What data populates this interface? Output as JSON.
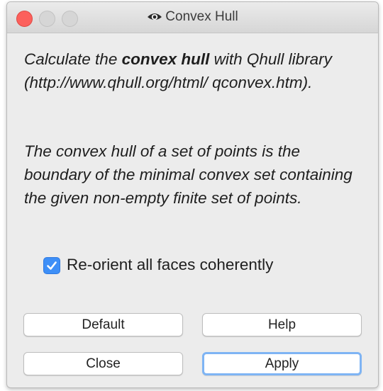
{
  "window": {
    "title": "Convex Hull",
    "app_icon": "meshlab-eye-icon"
  },
  "description": {
    "p1_before": "Calculate the ",
    "p1_bold": "convex hull",
    "p1_after": " with Qhull library (http://www.qhull.org/html/ qconvex.htm).",
    "p2": "The convex hull of a set of points is the boundary of the minimal convex set containing the given non-empty finite set of points."
  },
  "options": {
    "reorient_label": "Re-orient all faces coherently",
    "reorient_checked": true
  },
  "buttons": {
    "default_label": "Default",
    "help_label": "Help",
    "close_label": "Close",
    "apply_label": "Apply"
  },
  "colors": {
    "close_button": "#fc605c",
    "checkbox_accent": "#3e8ff7",
    "focus_ring": "#7eb4f4"
  }
}
